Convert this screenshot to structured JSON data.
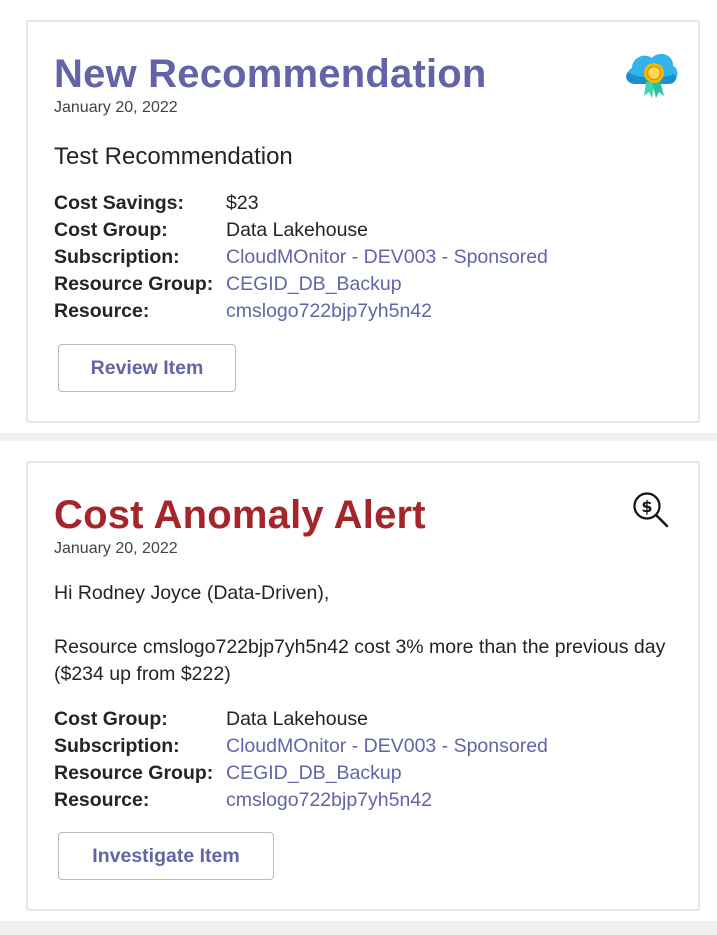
{
  "cards": [
    {
      "title": "New Recommendation",
      "date": "January 20, 2022",
      "subtitle": "Test Recommendation",
      "icon": "cloud-award-icon",
      "accent": "#6264a7",
      "facts": [
        {
          "label": "Cost Savings:",
          "value": "$23"
        },
        {
          "label": "Cost Group:",
          "value": "Data Lakehouse"
        },
        {
          "label": "Subscription:",
          "value": "CloudMOnitor - DEV003 - Sponsored"
        },
        {
          "label": "Resource Group:",
          "value": "CEGID_DB_Backup"
        },
        {
          "label": "Resource:",
          "value": "cmslogo722bjp7yh5n42"
        }
      ],
      "button_label": "Review Item"
    },
    {
      "title": "Cost Anomaly Alert",
      "date": "January 20, 2022",
      "greeting": "Hi Rodney Joyce (Data-Driven),",
      "message": "Resource cmslogo722bjp7yh5n42 cost 3% more than the previous day ($234 up from $222)",
      "icon": "dollar-search-icon",
      "accent": "#a4262c",
      "facts": [
        {
          "label": "Cost Group:",
          "value": "Data Lakehouse"
        },
        {
          "label": "Subscription:",
          "value": "CloudMOnitor - DEV003 - Sponsored"
        },
        {
          "label": "Resource Group:",
          "value": "CEGID_DB_Backup"
        },
        {
          "label": "Resource:",
          "value": "cmslogo722bjp7yh5n42"
        }
      ],
      "button_label": "Investigate Item"
    }
  ]
}
